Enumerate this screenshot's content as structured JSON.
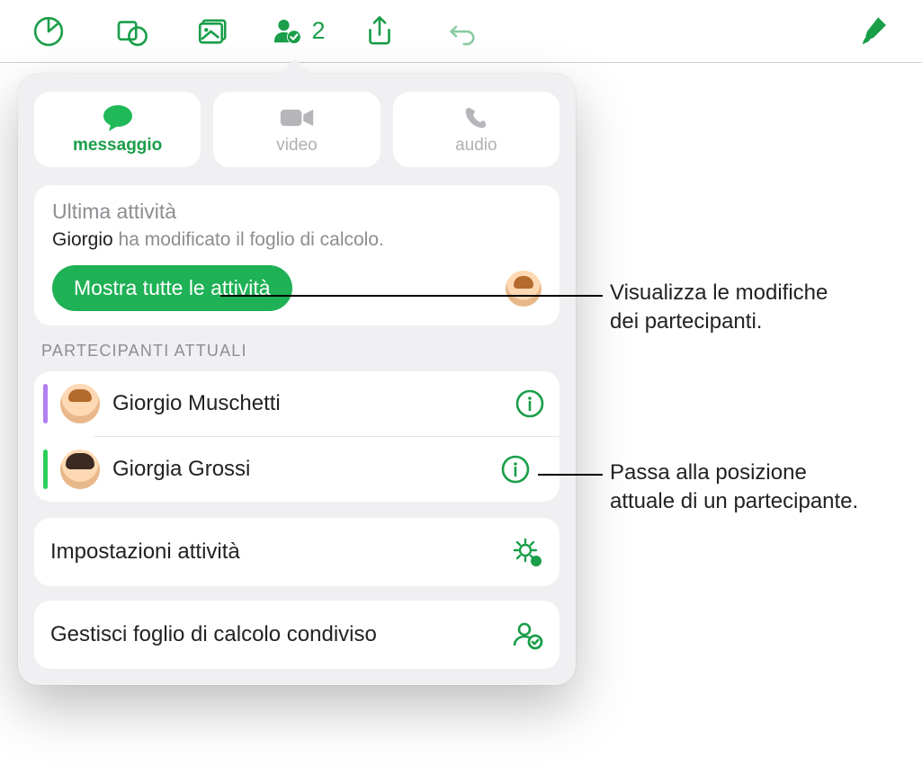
{
  "toolbar": {
    "collab_badge": "2"
  },
  "comm": {
    "message": "messaggio",
    "video": "video",
    "audio": "audio"
  },
  "activity": {
    "title": "Ultima attività",
    "who": "Giorgio",
    "rest": " ha modificato il foglio di calcolo.",
    "show_all": "Mostra tutte le attività"
  },
  "participants": {
    "header": "PARTECIPANTI ATTUALI",
    "items": [
      {
        "name": "Giorgio Muschetti"
      },
      {
        "name": "Giorgia Grossi"
      }
    ]
  },
  "settings": {
    "activity_settings": "Impostazioni attività",
    "manage_shared": "Gestisci foglio di calcolo condiviso"
  },
  "callouts": {
    "c1_l1": "Visualizza le modifiche",
    "c1_l2": "dei partecipanti.",
    "c2_l1": "Passa alla posizione",
    "c2_l2": "attuale di un partecipante."
  }
}
